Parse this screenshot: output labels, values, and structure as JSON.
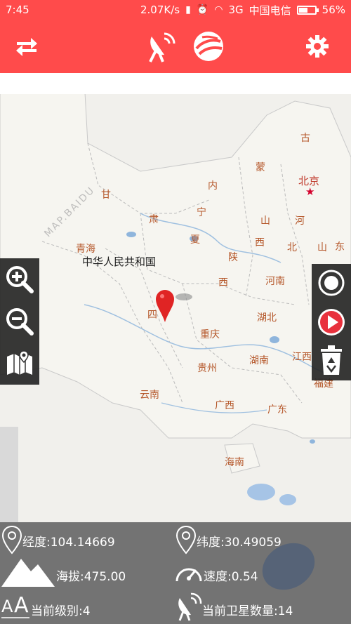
{
  "status_bar": {
    "time": "7:45",
    "net_speed": "2.07K/s",
    "network": "3G",
    "carrier": "中国电信",
    "battery": "56%",
    "battery_level": 0.56
  },
  "toolbar": {
    "icons": [
      "swap-icon",
      "satellite-dish-icon",
      "globe-icon",
      "gear-icon"
    ]
  },
  "map": {
    "country": "中华人民共和国",
    "capital": "北京",
    "watermark": "MAP.BAIDU",
    "provinces": {
      "gu": "古",
      "meng": "蒙",
      "nei": "内",
      "gan": "甘",
      "su": "肃",
      "ning": "宁",
      "xia": "夏",
      "qinghai": "青海",
      "shan": "山",
      "he": "河",
      "xi1": "西",
      "bei": "北",
      "shan2": "山",
      "dong": "东",
      "shaan": "陕",
      "xi2": "西",
      "henan": "河南",
      "si": "四",
      "hubei": "湖北",
      "chongqing": "重庆",
      "jiangxi": "江西",
      "hunan": "湖南",
      "guizhou": "贵州",
      "fujian": "福建",
      "yunnan": "云南",
      "guangxi": "广西",
      "guangdong": "广东",
      "hainan": "海南"
    }
  },
  "info": {
    "longitude": "经度:104.14669",
    "latitude": "纬度:30.49059",
    "altitude": "海拔:475.00",
    "speed": "速度:0.54",
    "level": "当前级别:4",
    "satellites": "当前卫星数量:14"
  },
  "colors": {
    "accent": "#ff4b4b",
    "info_bg": "#737373",
    "play": "#e8313d"
  }
}
